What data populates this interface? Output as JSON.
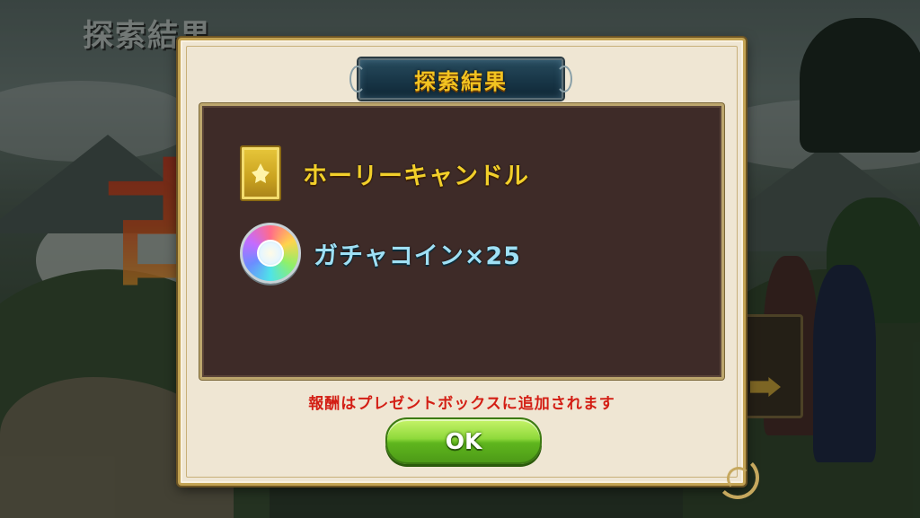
{
  "background": {
    "screen_title": "探索結果",
    "big_kanji": "古"
  },
  "dialog": {
    "title": "探索結果",
    "rewards": [
      {
        "icon": "holy-candle-icon",
        "label": "ホーリーキャンドル"
      },
      {
        "icon": "gacha-coin-icon",
        "label": "ガチャコイン×25"
      }
    ],
    "notice": "報酬はプレゼントボックスに追加されます",
    "ok_label": "OK"
  },
  "colors": {
    "title_text": "#f2c321",
    "item_gold": "#f2cf2a",
    "item_cyan": "#9fe0f5",
    "notice_red": "#d31e14",
    "ok_green": "#8fd93b"
  }
}
